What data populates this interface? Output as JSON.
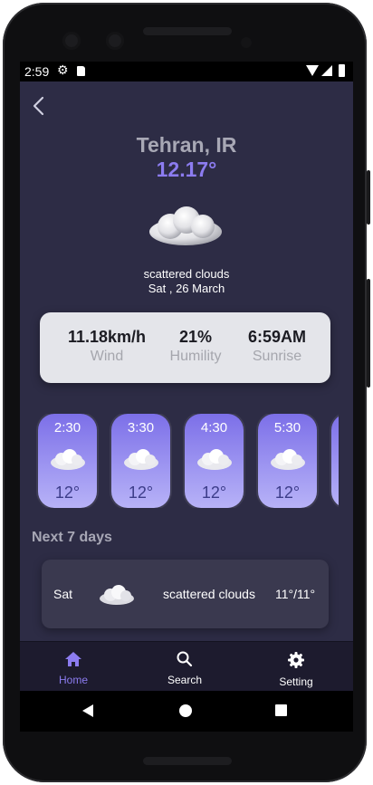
{
  "status_bar": {
    "time": "2:59"
  },
  "location": {
    "city": "Tehran, IR",
    "temperature": "12.17°"
  },
  "current": {
    "description": "scattered clouds",
    "date": "Sat , 26 March"
  },
  "stats": [
    {
      "value": "11.18km/h",
      "label": "Wind"
    },
    {
      "value": "21%",
      "label": "Humility"
    },
    {
      "value": "6:59AM",
      "label": "Sunrise"
    }
  ],
  "hourly": [
    {
      "time": "2:30",
      "temp": "12°"
    },
    {
      "time": "3:30",
      "temp": "12°"
    },
    {
      "time": "4:30",
      "temp": "12°"
    },
    {
      "time": "5:30",
      "temp": "12°"
    }
  ],
  "next_days_title": "Next 7 days",
  "forecast": [
    {
      "day": "Sat",
      "description": "scattered clouds",
      "temps": "11°/11°"
    }
  ],
  "bottom_nav": [
    {
      "label": "Home",
      "icon": "home-icon",
      "active": true
    },
    {
      "label": "Search",
      "icon": "search-icon",
      "active": false
    },
    {
      "label": "Setting",
      "icon": "gear-icon",
      "active": false
    }
  ],
  "colors": {
    "accent": "#8c7cf0",
    "background": "#2d2c45",
    "card": "#e4e5ea",
    "nav": "#1d1b2e"
  }
}
